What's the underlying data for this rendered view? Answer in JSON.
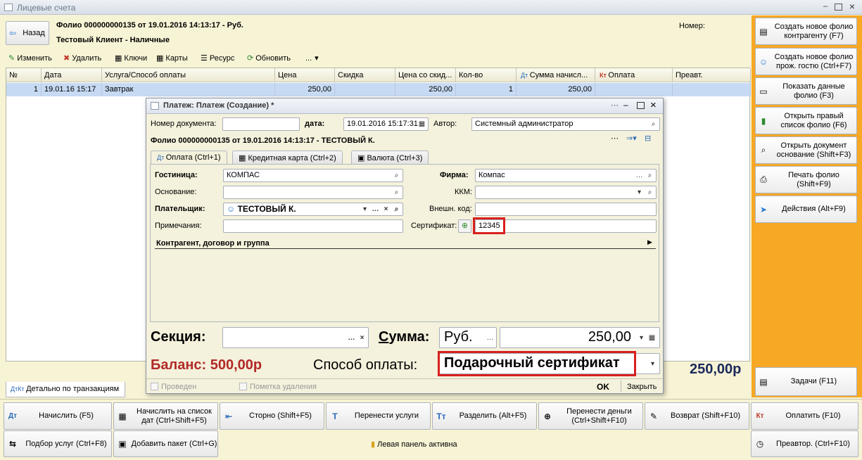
{
  "window": {
    "title": "Лицевые счета"
  },
  "header": {
    "back_label": "Назад",
    "folio_line": "Фолио 000000000135 от 19.01.2016 14:13:17 - Руб.",
    "client_line": "Тестовый Клиент - Наличные",
    "number_label": "Номер:"
  },
  "toolbar": {
    "edit": "Изменить",
    "delete": "Удалить",
    "keys": "Ключи",
    "cards": "Карты",
    "resource": "Ресурс",
    "refresh": "Обновить",
    "more": "..."
  },
  "grid": {
    "columns": [
      "№",
      "Дата",
      "Услуга/Способ оплаты",
      "Цена",
      "Скидка",
      "Цена со скид...",
      "Кол-во",
      "Сумма начисл...",
      "Оплата",
      "Преавт."
    ],
    "rows": [
      {
        "num": "1",
        "date": "19.01.16 15:17",
        "service": "Завтрак",
        "price": "250,00",
        "discount": "",
        "price_disc": "250,00",
        "qty": "1",
        "sum": "250,00",
        "payment": "",
        "preauth": ""
      }
    ]
  },
  "total": "250,00р",
  "bottom_tab": "Детально по транзакциям",
  "right_panel": {
    "items": [
      "Создать новое фолио контрагенту (F7)",
      "Создать новое фолио прож. гостю (Ctrl+F7)",
      "Показать данные фолио (F3)",
      "Открыть правый список фолио (F6)",
      "Открыть документ основание (Shift+F3)",
      "Печать фолио (Shift+F9)",
      "Действия (Alt+F9)"
    ],
    "tasks": "Задачи (F11)"
  },
  "bottom_bar": {
    "row1": [
      "Начислить (F5)",
      "Начислить на список дат (Ctrl+Shift+F5)",
      "Сторно (Shift+F5)",
      "Перенести услуги",
      "Разделить (Alt+F5)",
      "Перенести деньги (Ctrl+Shift+F10)",
      "Возврат (Shift+F10)",
      "Оплатить (F10)"
    ],
    "row2_left": [
      "Подбор услуг (Ctrl+F8)",
      "Добавить пакет (Ctrl+G)"
    ],
    "status": "Левая панель активна",
    "preauth": "Преавтор. (Ctrl+F10)"
  },
  "dialog": {
    "title": "Платеж: Платеж (Создание) *",
    "doc_number_label": "Номер документа:",
    "doc_number": "",
    "date_label": "дата:",
    "date": "19.01.2016 15:17:31",
    "author_label": "Автор:",
    "author": "Системный администратор",
    "folio_line": "Фолио 000000000135 от 19.01.2016 14:13:17 - ТЕСТОВЫЙ К.",
    "tabs": [
      "Оплата (Ctrl+1)",
      "Кредитная карта (Ctrl+2)",
      "Валюта (Ctrl+3)"
    ],
    "hotel_label": "Гостиница:",
    "hotel": "КОМПАС",
    "firm_label": "Фирма:",
    "firm": "Компас",
    "basis_label": "Основание:",
    "basis": "",
    "kkm_label": "ККМ:",
    "kkm": "",
    "payer_label": "Плательщик:",
    "payer": "ТЕСТОВЫЙ К.",
    "ext_code_label": "Внешн. код:",
    "ext_code": "",
    "notes_label": "Примечания:",
    "notes": "",
    "certificate_label": "Сертификат:",
    "certificate": "12345",
    "group_label": "Контрагент, договор и группа",
    "section_label": "Секция:",
    "section": "",
    "sum_label": "Сумма:",
    "currency": "Руб.",
    "sum": "250,00",
    "balance": "Баланс: 500,00р",
    "pay_method_label": "Способ оплаты:",
    "pay_method": "Подарочный сертификат",
    "posted_label": "Проведен",
    "deleted_label": "Пометка удаления",
    "ok": "OK",
    "close": "Закрыть"
  }
}
